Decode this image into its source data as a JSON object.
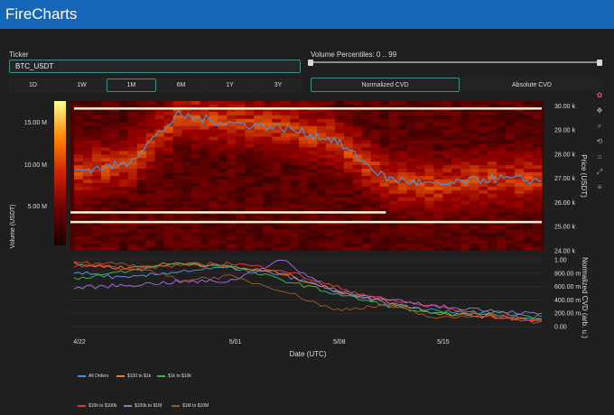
{
  "app": {
    "title": "FireCharts"
  },
  "ticker": {
    "label": "Ticker",
    "value": "BTC_USDT"
  },
  "volume_percentiles": {
    "label": "Volume Percentiles: 0 .. 99"
  },
  "ranges": [
    {
      "label": "1D",
      "active": false
    },
    {
      "label": "1W",
      "active": false
    },
    {
      "label": "1M",
      "active": true
    },
    {
      "label": "6M",
      "active": false
    },
    {
      "label": "1Y",
      "active": false
    },
    {
      "label": "3Y",
      "active": false
    }
  ],
  "cvd_modes": [
    {
      "label": "Normalized CVD",
      "active": true
    },
    {
      "label": "Absolute CVD",
      "active": false
    }
  ],
  "colorbar": {
    "title": "Volume (USDT)",
    "ticks": [
      "15.00 M",
      "10.00 M",
      "5.00 M"
    ]
  },
  "price_axis": {
    "title": "Price (USDT)",
    "ticks": [
      "30.00 k",
      "29.00 k",
      "28.00 k",
      "27.00 k",
      "26.00 k",
      "25.00 k",
      "24.00 k"
    ]
  },
  "cvd_axis": {
    "title": "Normalized CVD (arb. u.)",
    "ticks": [
      "1.00",
      "800.00 m",
      "600.00 m",
      "400.00 m",
      "200.00 m",
      "0.00"
    ]
  },
  "x_axis": {
    "title": "Date (UTC)",
    "ticks": [
      "4/22",
      "5/01",
      "5/08",
      "5/15"
    ]
  },
  "toolbar_icons": [
    "plotly-logo-icon",
    "pan-icon",
    "zoom-icon",
    "lasso-icon",
    "reset-icon",
    "autoscale-icon",
    "hover-icon"
  ],
  "legend": [
    {
      "name": "All Orders",
      "color": "#4a90e2"
    },
    {
      "name": "$100 to $1k",
      "color": "#f07a2a"
    },
    {
      "name": "$1k to $10k",
      "color": "#3cb44b"
    },
    {
      "name": "$10k to $100k",
      "color": "#e53935"
    },
    {
      "name": "$100k to $1M",
      "color": "#9c6ade"
    },
    {
      "name": "$1M to $10M",
      "color": "#a0522d"
    }
  ],
  "chart_data": [
    {
      "type": "heatmap",
      "title": "",
      "xlabel": "Date (UTC)",
      "ylabel": "Price (USDT)",
      "ylim": [
        24000,
        30200
      ],
      "colorbar_label": "Volume (USDT)",
      "colorbar_range": [
        0,
        18000000
      ],
      "x": [
        "4/22",
        "4/25",
        "4/28",
        "5/01",
        "5/04",
        "5/08",
        "5/11",
        "5/15",
        "5/18",
        "5/20"
      ],
      "price_line": [
        27300,
        27600,
        29600,
        29300,
        29100,
        28600,
        27000,
        26700,
        27000,
        26900
      ],
      "high_volume_levels": [
        {
          "price": 29900,
          "from": "4/22",
          "to": "5/20"
        },
        {
          "price": 25400,
          "from": "4/24",
          "to": "4/26"
        },
        {
          "price": 25600,
          "from": "4/27",
          "to": "5/11"
        },
        {
          "price": 25200,
          "from": "5/12",
          "to": "5/20"
        }
      ]
    },
    {
      "type": "line",
      "title": "",
      "xlabel": "Date (UTC)",
      "ylabel": "Normalized CVD (arb. u.)",
      "ylim": [
        0,
        1
      ],
      "x": [
        "4/22",
        "4/25",
        "4/28",
        "5/01",
        "5/04",
        "5/08",
        "5/11",
        "5/15",
        "5/18",
        "5/20"
      ],
      "series": [
        {
          "name": "All Orders",
          "values": [
            0.82,
            0.72,
            0.83,
            0.88,
            0.78,
            0.55,
            0.35,
            0.23,
            0.18,
            0.12
          ]
        },
        {
          "name": "$100 to $1k",
          "values": [
            0.93,
            0.88,
            0.95,
            0.9,
            0.8,
            0.55,
            0.38,
            0.2,
            0.15,
            0.1
          ]
        },
        {
          "name": "$1k to $10k",
          "values": [
            0.72,
            0.82,
            0.95,
            0.9,
            0.7,
            0.5,
            0.32,
            0.18,
            0.22,
            0.14
          ]
        },
        {
          "name": "$10k to $100k",
          "values": [
            1.0,
            0.85,
            0.92,
            0.95,
            0.85,
            0.6,
            0.4,
            0.3,
            0.15,
            0.08
          ]
        },
        {
          "name": "$100k to $1M",
          "values": [
            0.58,
            0.62,
            0.67,
            0.68,
            1.0,
            0.52,
            0.4,
            0.3,
            0.25,
            0.18
          ]
        },
        {
          "name": "$1M to $10M",
          "values": [
            0.9,
            0.95,
            0.7,
            0.75,
            0.55,
            0.25,
            0.32,
            0.12,
            0.18,
            0.05
          ]
        }
      ]
    }
  ]
}
